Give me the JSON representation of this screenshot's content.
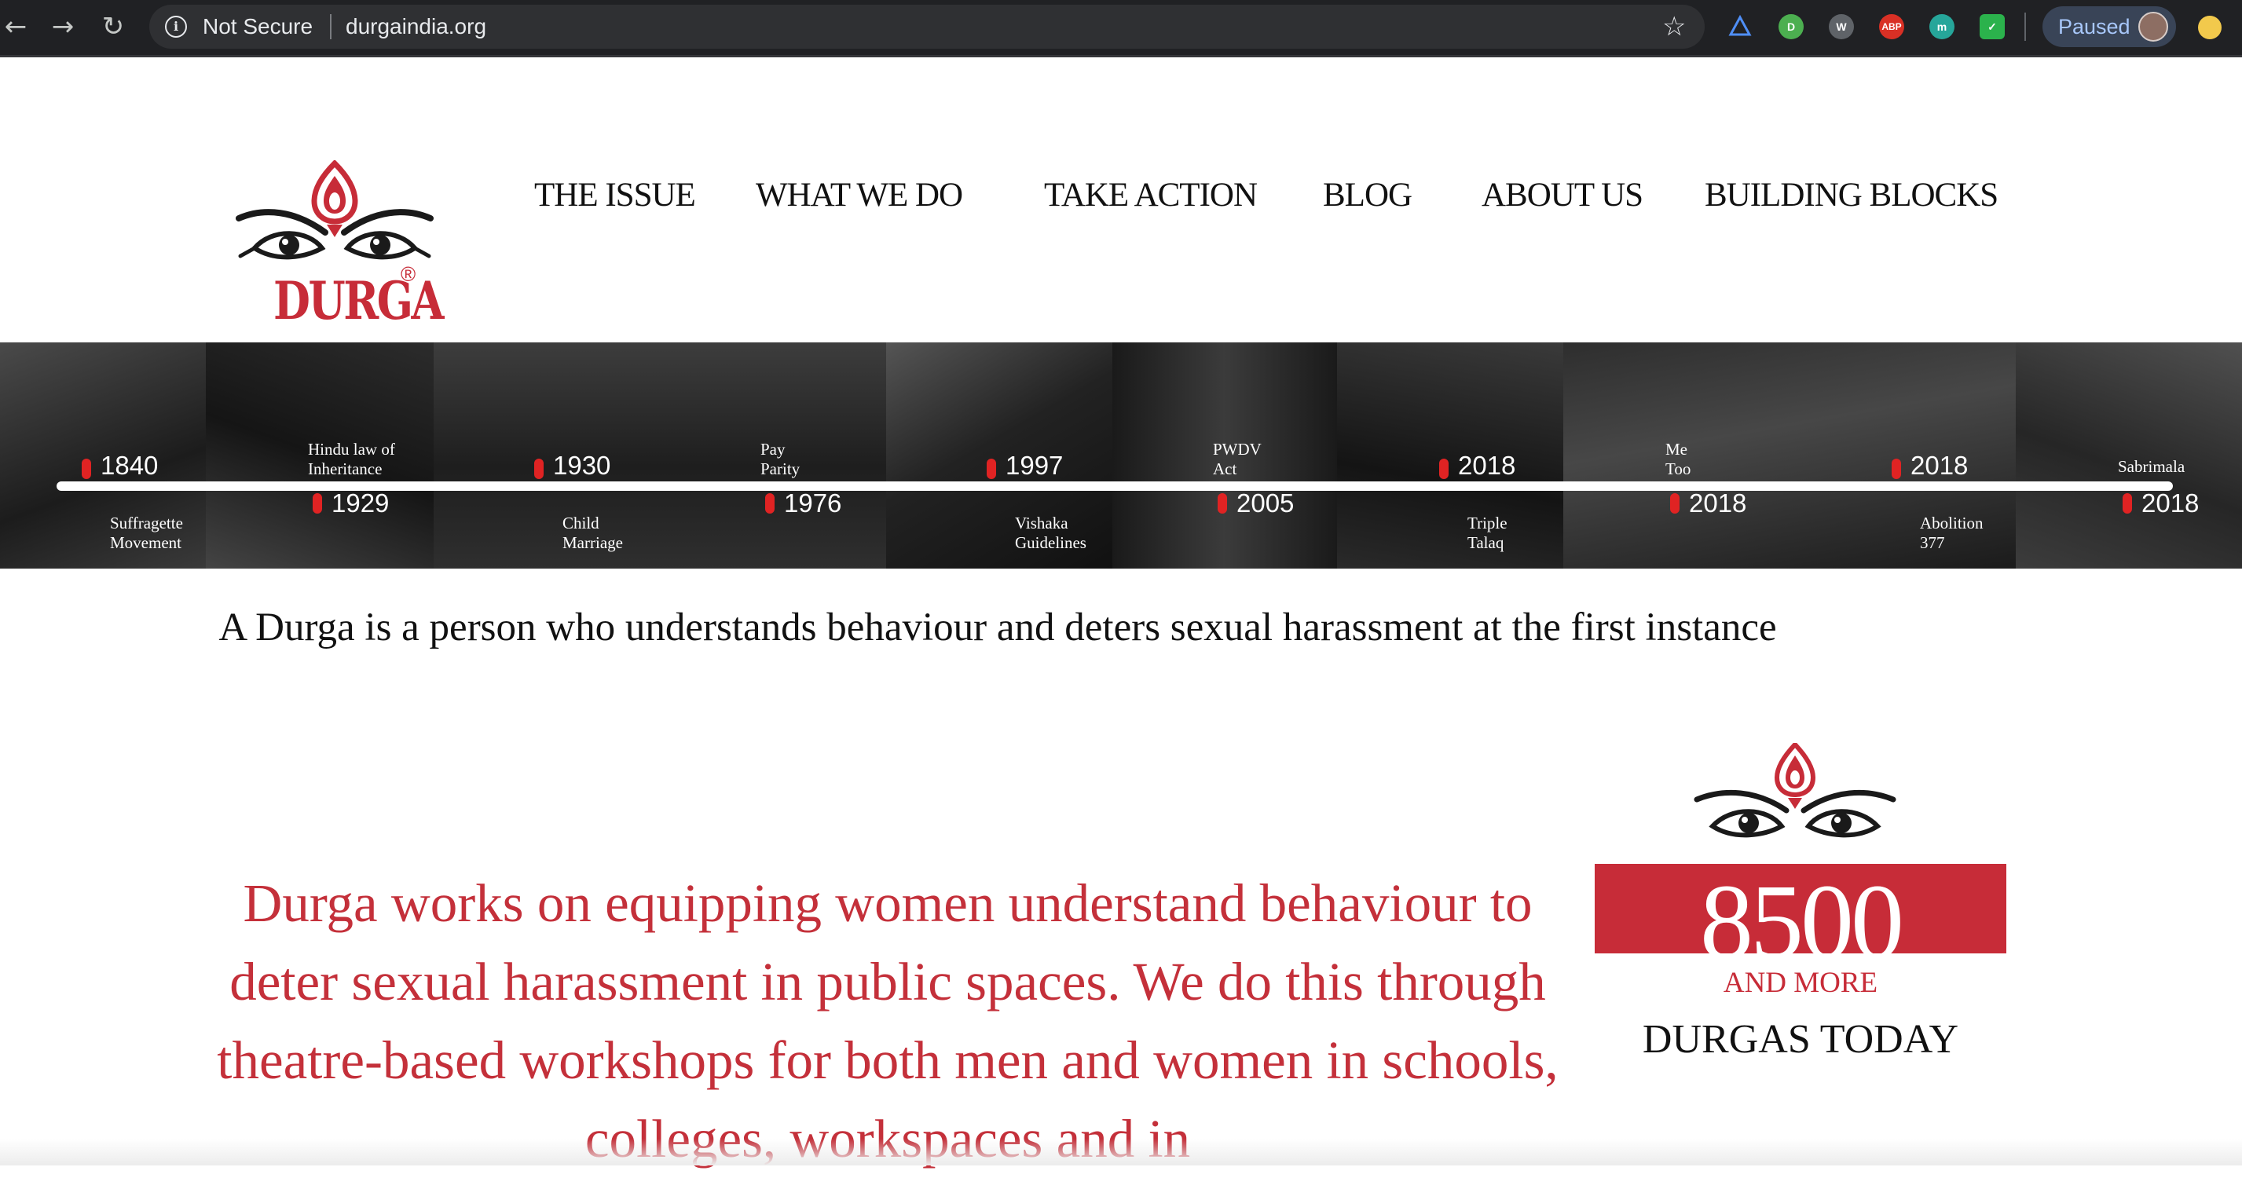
{
  "browser": {
    "back_icon": "←",
    "forward_icon": "→",
    "reload_icon": "↻",
    "security_label": "Not Secure",
    "url": "durgaindia.org",
    "star_icon": "☆",
    "extensions": [
      {
        "name": "drive-extension",
        "label": "",
        "color": "#1a73e8"
      },
      {
        "name": "pushbullet-extension",
        "label": "D",
        "color": "#4caf50"
      },
      {
        "name": "w-extension",
        "label": "W",
        "color": "#5f6368"
      },
      {
        "name": "adblock-plus-extension",
        "label": "ABP",
        "color": "#d93025"
      },
      {
        "name": "m-extension",
        "label": "m",
        "color": "#26a69a"
      },
      {
        "name": "feedly-extension",
        "label": "✓",
        "color": "#2bb24c"
      }
    ],
    "profile_label": "Paused"
  },
  "site": {
    "logo_text": "DURGA",
    "registered_mark": "®",
    "brand_color": "#c72c38",
    "nav": [
      "THE ISSUE",
      "WHAT WE DO",
      "TAKE ACTION",
      "BLOG",
      "ABOUT US",
      "BUILDING BLOCKS"
    ]
  },
  "timeline": {
    "events": [
      {
        "year": "1840",
        "label": "Suffragette\nMovement",
        "side": "top"
      },
      {
        "year": "1929",
        "label": "Hindu law of\nInheritance",
        "side": "bottom"
      },
      {
        "year": "1930",
        "label": "Child\nMarriage",
        "side": "top"
      },
      {
        "year": "1976",
        "label": "Pay\nParity",
        "side": "bottom"
      },
      {
        "year": "1997",
        "label": "Vishaka\nGuidelines",
        "side": "top"
      },
      {
        "year": "2005",
        "label": "PWDV\nAct",
        "side": "bottom"
      },
      {
        "year": "2018",
        "label": "Triple\nTalaq",
        "side": "top"
      },
      {
        "year": "2018",
        "label": "Me\nToo",
        "side": "bottom"
      },
      {
        "year": "2018",
        "label": "Abolition\n377",
        "side": "top"
      },
      {
        "year": "2018",
        "label": "Sabrimala",
        "side": "bottom"
      }
    ]
  },
  "content": {
    "tagline": "A Durga is a person who understands behaviour and deters sexual harassment at the first instance",
    "mission": "Durga works on equipping women understand behaviour to deter sexual harassment in public spaces. We do this through theatre-based workshops for both men and women in schools, colleges, workspaces and in",
    "stat": {
      "count": "8500",
      "and_more": "AND MORE",
      "caption": "DURGAS TODAY"
    }
  }
}
